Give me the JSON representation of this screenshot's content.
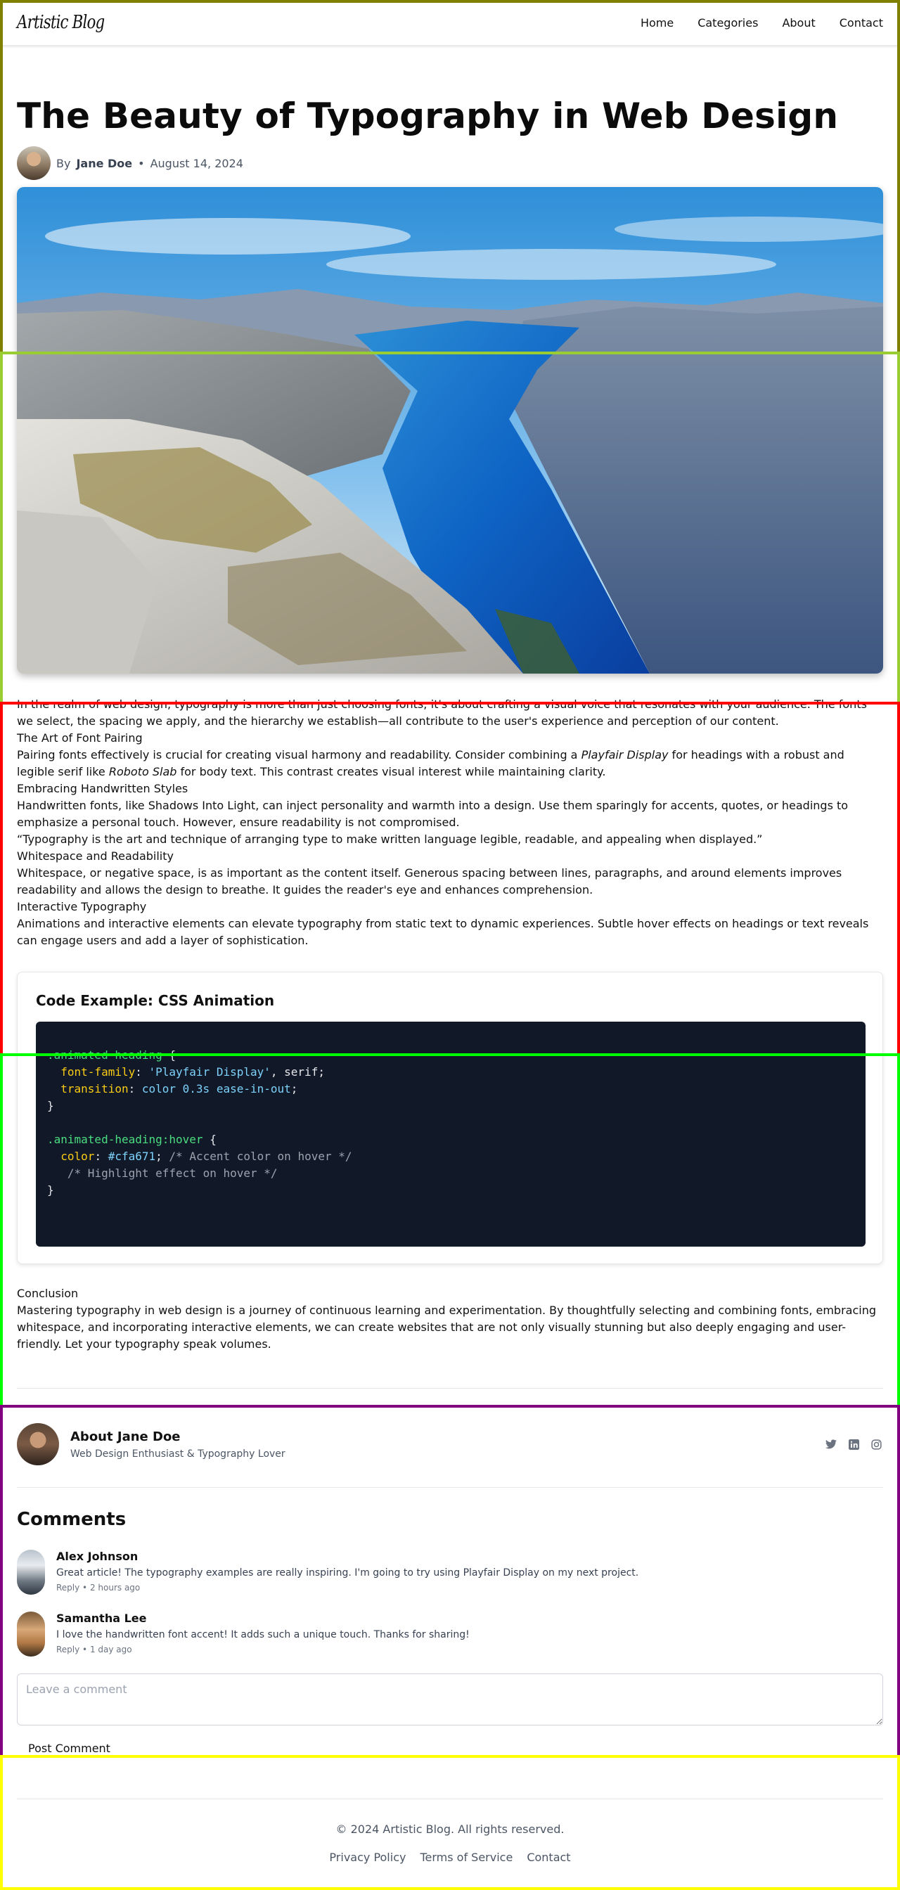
{
  "nav": {
    "brand": "Artistic Blog",
    "links": [
      "Home",
      "Categories",
      "About",
      "Contact"
    ]
  },
  "post": {
    "title": "The Beauty of Typography in Web Design",
    "by_prefix": "By",
    "author": "Jane Doe",
    "separator": "•",
    "date": "August 14, 2024",
    "hero_image": "fjord-landscape-photo"
  },
  "article": {
    "intro": "In the realm of web design, typography is more than just choosing fonts; it's about crafting a visual voice that resonates with your audience. The fonts we select, the spacing we apply, and the hierarchy we establish—all contribute to the user's experience and perception of our content.",
    "h_pairing": "The Art of Font Pairing",
    "p_pairing_1": "Pairing fonts effectively is crucial for creating visual harmony and readability. Consider combining a ",
    "p_pairing_font1": "Playfair Display",
    "p_pairing_2": " for headings with a robust and legible serif like ",
    "p_pairing_font2": "Roboto Slab",
    "p_pairing_3": " for body text. This contrast creates visual interest while maintaining clarity.",
    "h_handwritten": "Embracing Handwritten Styles",
    "p_handwritten": "Handwritten fonts, like Shadows Into Light, can inject personality and warmth into a design. Use them sparingly for accents, quotes, or headings to emphasize a personal touch. However, ensure readability is not compromised.",
    "quote": "“Typography is the art and technique of arranging type to make written language legible, readable, and appealing when displayed.”",
    "h_whitespace": "Whitespace and Readability",
    "p_whitespace": "Whitespace, or negative space, is as important as the content itself. Generous spacing between lines, paragraphs, and around elements improves readability and allows the design to breathe. It guides the reader's eye and enhances comprehension.",
    "h_interactive": "Interactive Typography",
    "p_interactive": "Animations and interactive elements can elevate typography from static text to dynamic experiences. Subtle hover effects on headings or text reveals can engage users and add a layer of sophistication."
  },
  "code": {
    "title": "Code Example: CSS Animation",
    "l1_sel": ".animated-heading",
    "l1_brace": " {",
    "l2_prop": "font-family",
    "l2_colon": ": ",
    "l2_str": "'Playfair Display'",
    "l2_rest": ", serif;",
    "l3_prop": "transition",
    "l3_colon": ": ",
    "l3_val": "color 0.3s ease-in-out",
    "l3_semi": ";",
    "l4": "}",
    "l6_sel": ".animated-heading:hover",
    "l6_brace": " {",
    "l7_prop": "color",
    "l7_colon": ": ",
    "l7_val": "#cfa671",
    "l7_semi": ";",
    "l7_comment": " /* Accent color on hover */",
    "l8_comment": "/* Highlight effect on hover */",
    "l9": "}"
  },
  "conclusion": {
    "heading": "Conclusion",
    "text": "Mastering typography in web design is a journey of continuous learning and experimentation. By thoughtfully selecting and combining fonts, embracing whitespace, and incorporating interactive elements, we can create websites that are not only visually stunning but also deeply engaging and user-friendly. Let your typography speak volumes."
  },
  "author_box": {
    "name": "About Jane Doe",
    "subtitle": "Web Design Enthusiast & Typography Lover",
    "socials": [
      "twitter-icon",
      "linkedin-icon",
      "instagram-icon"
    ]
  },
  "comments": {
    "heading": "Comments",
    "items": [
      {
        "name": "Alex Johnson",
        "text": "Great article! The typography examples are really inspiring. I'm going to try using Playfair Display on my next project.",
        "meta": "Reply • 2 hours ago"
      },
      {
        "name": "Samantha Lee",
        "text": "I love the handwritten font accent! It adds such a unique touch. Thanks for sharing!",
        "meta": "Reply • 1 day ago"
      }
    ],
    "placeholder": "Leave a comment",
    "post_label": "Post Comment"
  },
  "footer": {
    "copyright": "© 2024 Artistic Blog. All rights reserved.",
    "links": [
      "Privacy Policy",
      "Terms of Service",
      "Contact"
    ]
  },
  "colors": {
    "accent": "#cfa671",
    "code_bg": "#111827",
    "frame_1": "#808000",
    "frame_2": "#9acd32",
    "frame_3": "#ff0000",
    "frame_4": "#00ff00",
    "frame_5": "#800080",
    "frame_6": "#ffff00"
  }
}
